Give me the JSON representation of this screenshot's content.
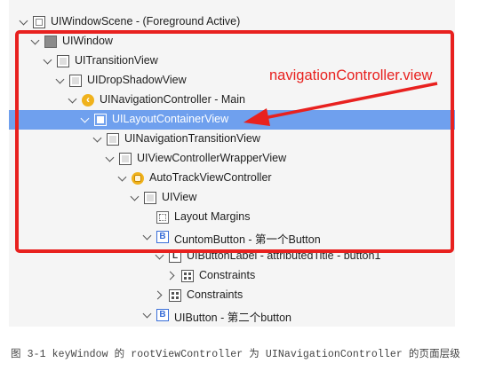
{
  "rows": [
    {
      "label": "UIWindowScene - (Foreground Active)",
      "icon": "scene-icon"
    },
    {
      "label": "UIWindow",
      "icon": "window-icon"
    },
    {
      "label": "UITransitionView",
      "icon": "view-icon"
    },
    {
      "label": "UIDropShadowView",
      "icon": "view-icon"
    },
    {
      "label": "UINavigationController - Main",
      "icon": "navigation-controller-icon"
    },
    {
      "label": "UILayoutContainerView",
      "icon": "view-icon"
    },
    {
      "label": "UINavigationTransitionView",
      "icon": "view-icon"
    },
    {
      "label": "UIViewControllerWrapperView",
      "icon": "view-icon"
    },
    {
      "label": "AutoTrackViewController",
      "icon": "view-controller-icon"
    },
    {
      "label": "UIView",
      "icon": "view-icon"
    },
    {
      "label": "Layout Margins",
      "icon": "layout-margins-icon"
    },
    {
      "label": "CuntomButton - 第一个Button",
      "icon": "button-icon"
    },
    {
      "label": "UIButtonLabel - attributedTitle - button1",
      "icon": "label-icon"
    },
    {
      "label": "Constraints",
      "icon": "constraints-icon"
    },
    {
      "label": "Constraints",
      "icon": "constraints-icon"
    },
    {
      "label": "UIButton - 第二个button",
      "icon": "button-icon"
    }
  ],
  "icons": {
    "navigation_controller_glyph": "‹",
    "button_glyph": "B",
    "label_glyph": "L"
  },
  "selected_row": "UILayoutContainerView",
  "annotation": {
    "text": "navigationController.view",
    "color": "#e8211f"
  },
  "caption": "图 3-1 keyWindow 的 rootViewController 为 UINavigationController 的页面层级",
  "colors": {
    "selection": "#6fa0ee",
    "highlight": "#e8211f",
    "panel_bg": "#f5f5f5"
  }
}
